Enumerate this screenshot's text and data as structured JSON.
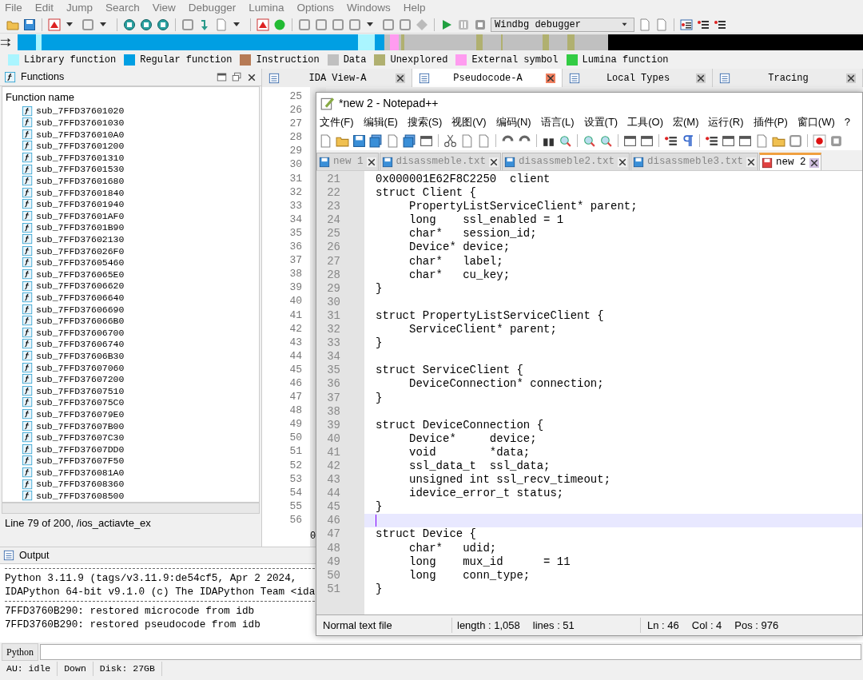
{
  "menu": [
    "File",
    "Edit",
    "Jump",
    "Search",
    "View",
    "Debugger",
    "Lumina",
    "Options",
    "Windows",
    "Help"
  ],
  "debugger_select": {
    "value": "Windbg debugger"
  },
  "legend": [
    {
      "label": "Library function",
      "color": "#aaf5ff"
    },
    {
      "label": "Regular function",
      "color": "#009fe3"
    },
    {
      "label": "Instruction",
      "color": "#b67a55"
    },
    {
      "label": "Data",
      "color": "#c0c0c0"
    },
    {
      "label": "Unexplored",
      "color": "#b0b070"
    },
    {
      "label": "External symbol",
      "color": "#ff9cf0"
    },
    {
      "label": "Lumina function",
      "color": "#33cc44"
    }
  ],
  "functions_panel": {
    "title": "Functions",
    "column": "Function name",
    "items": [
      "sub_7FFD37601020",
      "sub_7FFD37601030",
      "sub_7FFD376010A0",
      "sub_7FFD37601200",
      "sub_7FFD37601310",
      "sub_7FFD37601530",
      "sub_7FFD37601680",
      "sub_7FFD37601840",
      "sub_7FFD37601940",
      "sub_7FFD37601AF0",
      "sub_7FFD37601B90",
      "sub_7FFD37602130",
      "sub_7FFD376026F0",
      "sub_7FFD37605460",
      "sub_7FFD376065E0",
      "sub_7FFD37606620",
      "sub_7FFD37606640",
      "sub_7FFD37606690",
      "sub_7FFD376066B0",
      "sub_7FFD37606700",
      "sub_7FFD37606740",
      "sub_7FFD37606B30",
      "sub_7FFD37607060",
      "sub_7FFD37607200",
      "sub_7FFD37607510",
      "sub_7FFD376075C0",
      "sub_7FFD376079E0",
      "sub_7FFD37607B00",
      "sub_7FFD37607C30",
      "sub_7FFD37607DD0",
      "sub_7FFD37607F50",
      "sub_7FFD376081A0",
      "sub_7FFD37608360",
      "sub_7FFD37608500"
    ],
    "status": "Line 79 of 200, /ios_actiavte_ex"
  },
  "ida_tabs": [
    {
      "label": "IDA View-A",
      "selected": false
    },
    {
      "label": "Pseudocode-A",
      "selected": true
    },
    {
      "label": "Local Types",
      "selected": false
    },
    {
      "label": "Tracing",
      "selected": false
    }
  ],
  "pseudocode": {
    "line_numbers": [
      "25",
      "26",
      "27",
      "28",
      "29",
      "30",
      "31",
      "32",
      "33",
      "34",
      "35",
      "36",
      "37",
      "38",
      "39",
      "40",
      "41",
      "42",
      "43",
      "44",
      "45",
      "46",
      "47",
      "48",
      "49",
      "50",
      "51",
      "52",
      "53",
      "54",
      "55",
      "56"
    ],
    "fragment": "0"
  },
  "output": {
    "title": "Output",
    "lines": [
      "Python 3.11.9 (tags/v3.11.9:de54cf5, Apr  2 2024, ",
      "IDAPython 64-bit v9.1.0 (c) The IDAPython Team <ida",
      "7FFD3760B290: restored microcode from idb",
      "7FFD3760B290: restored pseudocode from idb"
    ]
  },
  "python": {
    "button": "Python"
  },
  "status_bar": [
    "AU:  idle",
    "Down",
    "Disk: 27GB"
  ],
  "notepad": {
    "title": "*new 2 - Notepad++",
    "menu": [
      "文件(F)",
      "编辑(E)",
      "搜索(S)",
      "视图(V)",
      "编码(N)",
      "语言(L)",
      "设置(T)",
      "工具(O)",
      "宏(M)",
      "运行(R)",
      "插件(P)",
      "窗口(W)",
      "?"
    ],
    "tabs": [
      {
        "label": "new 1",
        "selected": false,
        "modified": false
      },
      {
        "label": "disassmeble.txt",
        "selected": false,
        "modified": false
      },
      {
        "label": "disassmeble2.txt",
        "selected": false,
        "modified": false
      },
      {
        "label": "disassmeble3.txt",
        "selected": false,
        "modified": false
      },
      {
        "label": "new 2",
        "selected": true,
        "modified": true
      }
    ],
    "lines": [
      {
        "number": "21",
        "text": "0x000001E62F8C2250  client",
        "current": false
      },
      {
        "number": "22",
        "text": "struct Client {",
        "current": false
      },
      {
        "number": "23",
        "text": "     PropertyListServiceClient* parent;",
        "current": false
      },
      {
        "number": "24",
        "text": "     long    ssl_enabled = 1",
        "current": false
      },
      {
        "number": "25",
        "text": "     char*   session_id;",
        "current": false
      },
      {
        "number": "26",
        "text": "     Device* device;",
        "current": false
      },
      {
        "number": "27",
        "text": "     char*   label;",
        "current": false
      },
      {
        "number": "28",
        "text": "     char*   cu_key;",
        "current": false
      },
      {
        "number": "29",
        "text": "}",
        "current": false
      },
      {
        "number": "30",
        "current": false
      },
      {
        "number": "31",
        "text": "struct PropertyListServiceClient {",
        "current": false
      },
      {
        "number": "32",
        "text": "     ServiceClient* parent;",
        "current": false
      },
      {
        "number": "33",
        "text": "}",
        "current": false
      },
      {
        "number": "34",
        "current": false
      },
      {
        "number": "35",
        "text": "struct ServiceClient {",
        "current": false
      },
      {
        "number": "36",
        "text": "     DeviceConnection* connection;",
        "current": false
      },
      {
        "number": "37",
        "text": "}",
        "current": false
      },
      {
        "number": "38",
        "current": false
      },
      {
        "number": "39",
        "text": "struct DeviceConnection {",
        "current": false
      },
      {
        "number": "40",
        "text": "     Device*     device;",
        "current": false
      },
      {
        "number": "41",
        "text": "     void        *data;",
        "current": false
      },
      {
        "number": "42",
        "text": "     ssl_data_t  ssl_data;",
        "current": false
      },
      {
        "number": "43",
        "text": "     unsigned int ssl_recv_timeout;",
        "current": false
      },
      {
        "number": "44",
        "text": "     idevice_error_t status;",
        "current": false
      },
      {
        "number": "45",
        "text": "}",
        "current": false
      },
      {
        "number": "46",
        "current": true
      },
      {
        "number": "47",
        "text": "struct Device {",
        "current": false
      },
      {
        "number": "48",
        "text": "     char*   udid;",
        "current": false
      },
      {
        "number": "49",
        "text": "     long    mux_id      = 11",
        "current": false
      },
      {
        "number": "50",
        "text": "     long    conn_type;",
        "current": false
      },
      {
        "number": "51",
        "text": "}",
        "current": false
      }
    ],
    "status": {
      "type": "Normal text file",
      "length": "length : 1,058",
      "lines": "lines : 51",
      "ln": "Ln : 46",
      "col": "Col : 4",
      "pos": "Pos : 976"
    }
  }
}
